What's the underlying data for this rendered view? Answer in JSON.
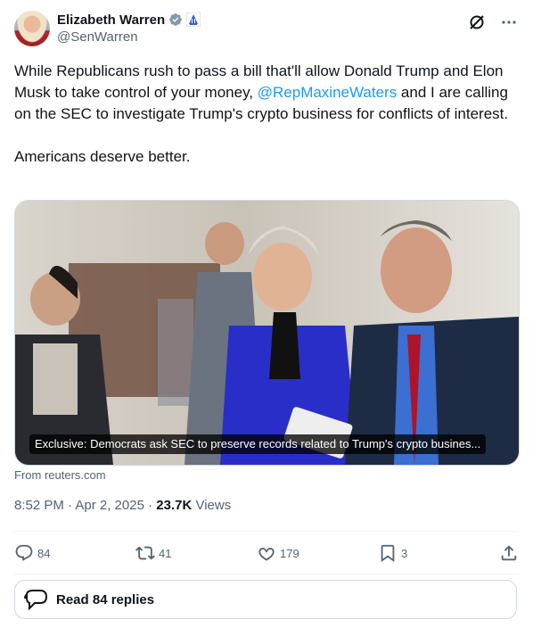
{
  "author": {
    "name": "Elizabeth Warren",
    "handle": "@SenWarren"
  },
  "tweet": {
    "text_before": "While Republicans rush to pass a bill that'll allow Donald Trump and Elon Musk to take control of your money, ",
    "mention": "@RepMaxineWaters",
    "text_after": " and I are calling on the SEC to investigate Trump's crypto business for conflicts of interest.\n\nAmericans deserve better."
  },
  "card": {
    "caption": "Exclusive: Democrats ask SEC to preserve records related to Trump's crypto busines...",
    "source": "From reuters.com"
  },
  "meta": {
    "time_date": "8:52 PM · Apr 2, 2025 · ",
    "views_count": "23.7K",
    "views_label": " Views"
  },
  "actions": {
    "replies": "84",
    "reposts": "41",
    "likes": "179",
    "bookmarks": "3"
  },
  "read_replies": "Read 84 replies",
  "colors": {
    "accent": "#1d9bf0",
    "muted": "#536471",
    "text": "#0f1419",
    "verified": "#829aab"
  },
  "icons": [
    "verified-badge-icon",
    "government-badge-icon",
    "grok-icon",
    "more-icon",
    "reply-icon",
    "repost-icon",
    "like-icon",
    "bookmark-icon",
    "share-icon",
    "chat-bubble-icon"
  ]
}
